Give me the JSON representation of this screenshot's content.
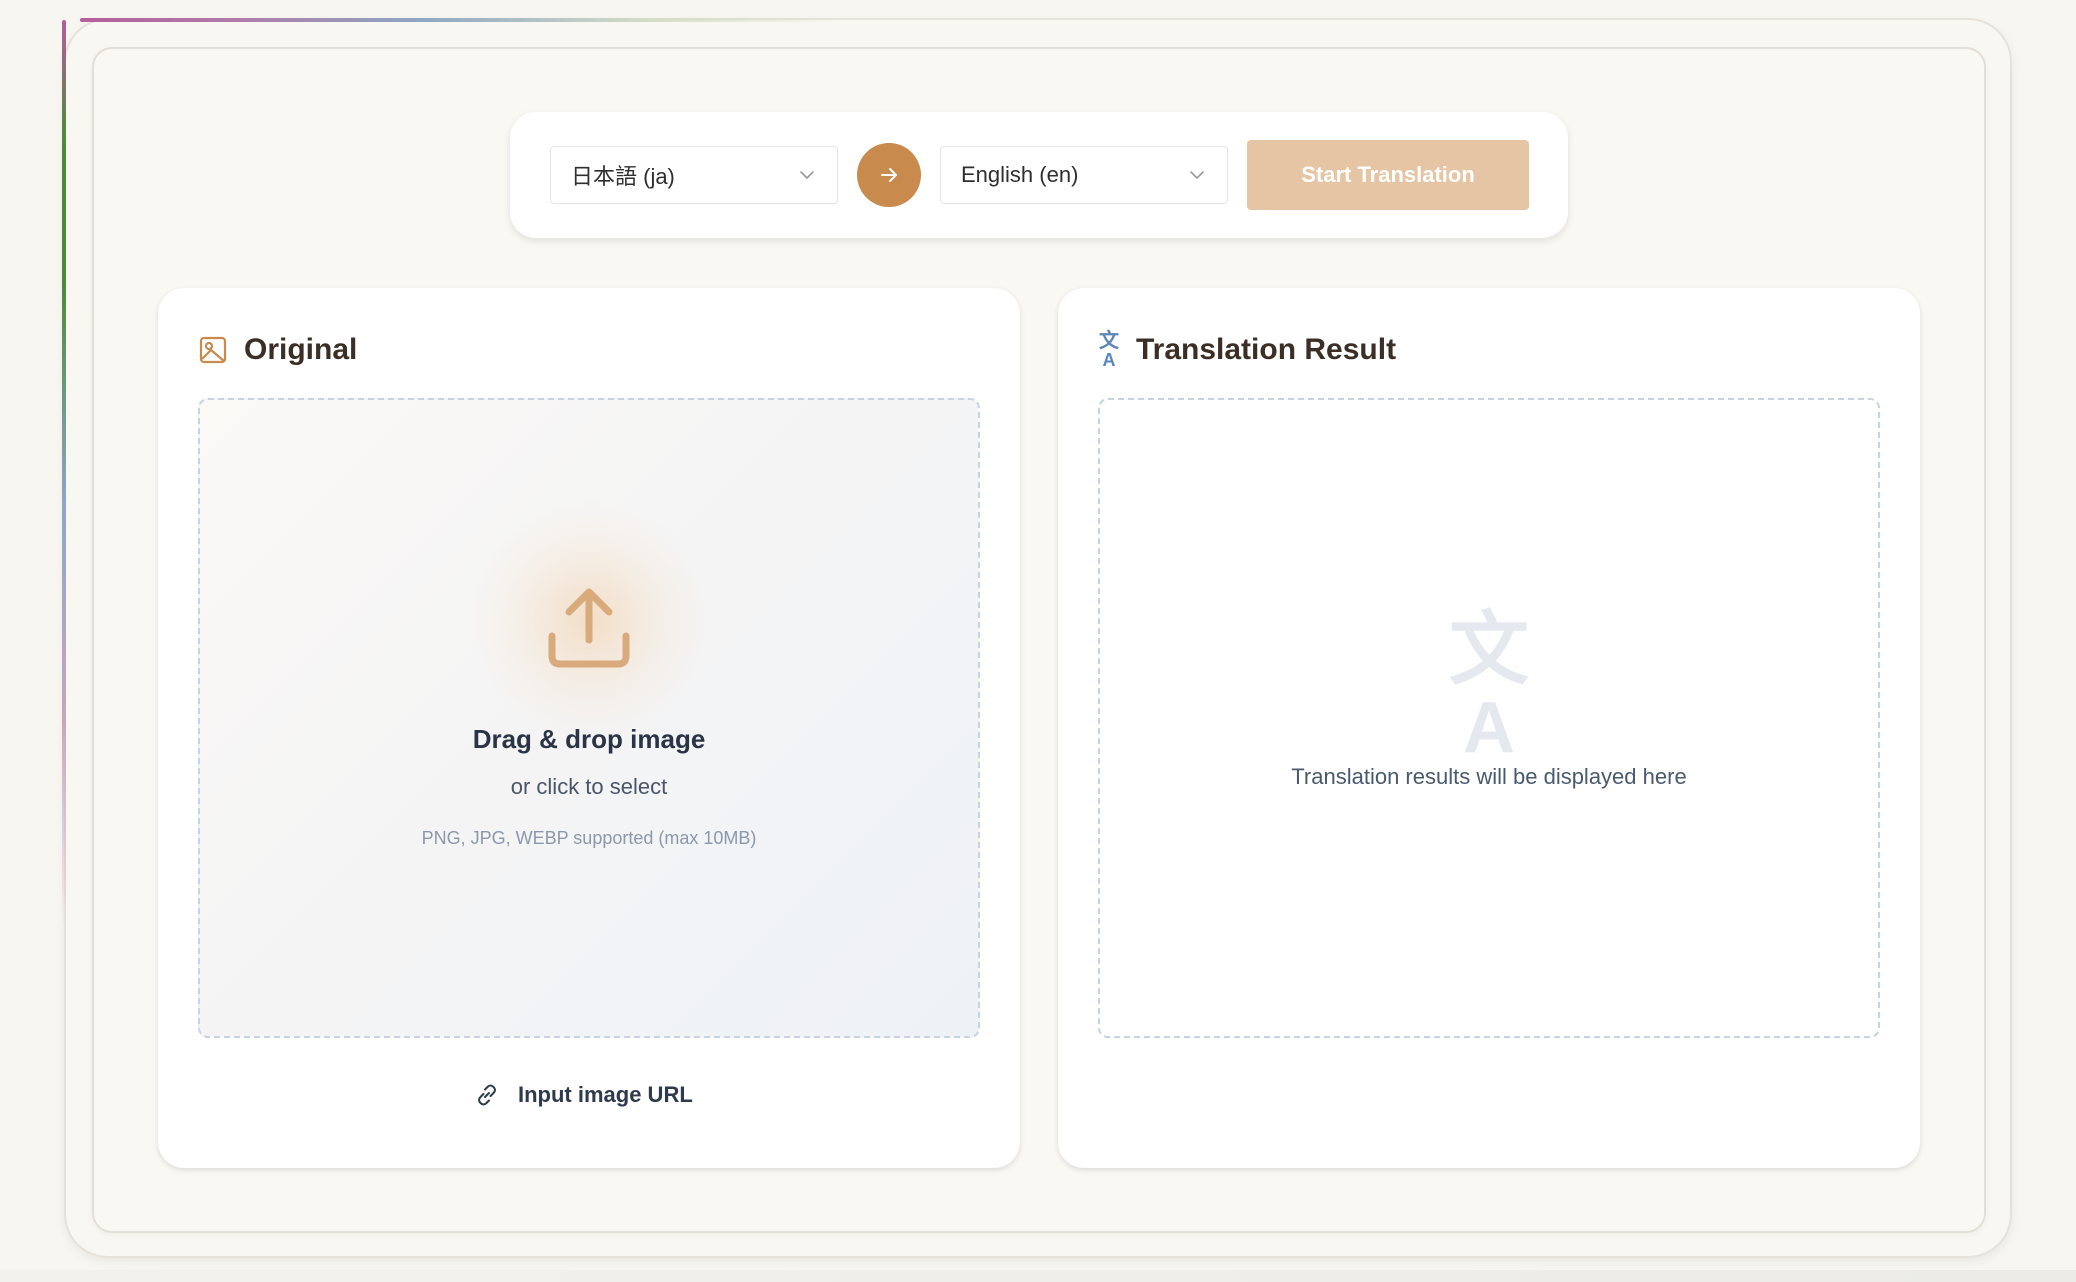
{
  "toolbar": {
    "source_language": "日本語 (ja)",
    "target_language": "English (en)",
    "start_label": "Start Translation"
  },
  "original": {
    "title": "Original",
    "drop_title": "Drag & drop image",
    "drop_sub": "or click to select",
    "drop_hint": "PNG, JPG, WEBP supported (max 10MB)",
    "url_label": "Input image URL"
  },
  "result": {
    "title": "Translation Result",
    "icon_top": "文",
    "icon_bottom": "A",
    "placeholder": "Translation results will be displayed here"
  },
  "colors": {
    "accent": "#c98a4d",
    "start_button": "#e6c5a5",
    "translate_icon": "#5b86b8"
  }
}
